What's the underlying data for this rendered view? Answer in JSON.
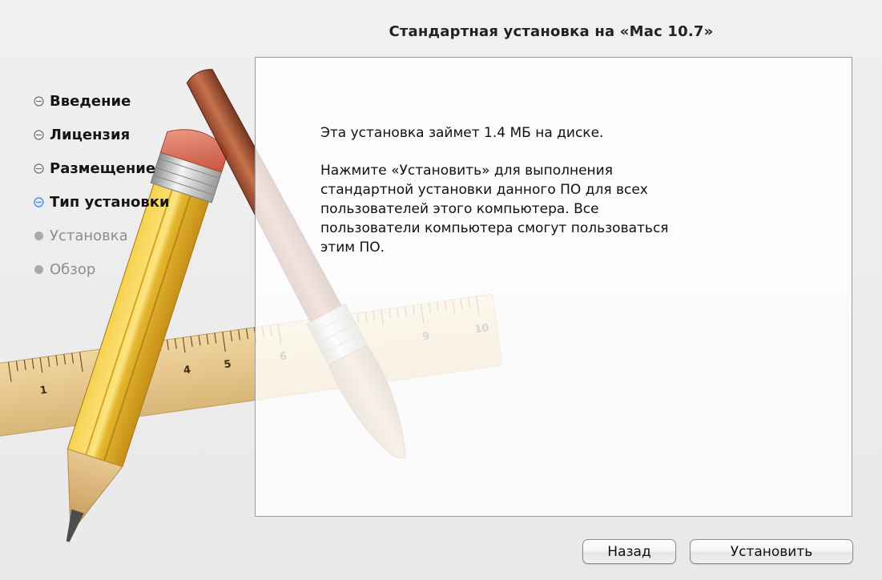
{
  "header": {
    "title": "Стандартная установка на «Mac 10.7»"
  },
  "steps": [
    {
      "label": "Введение",
      "state": "done"
    },
    {
      "label": "Лицензия",
      "state": "done"
    },
    {
      "label": "Размещение",
      "state": "done"
    },
    {
      "label": "Тип установки",
      "state": "current"
    },
    {
      "label": "Установка",
      "state": "pending"
    },
    {
      "label": "Обзор",
      "state": "pending"
    }
  ],
  "content": {
    "paragraph1": "Эта установка займет 1.4 МБ на диске.",
    "paragraph2": "Нажмите «Установить» для выполнения\nстандартной установки данного ПО для всех\nпользователей этого компьютера. Все\nпользователи компьютера смогут пользоваться\nэтим ПО."
  },
  "buttons": {
    "back": "Назад",
    "install": "Установить"
  },
  "colors": {
    "current_step": "#4f8fe0",
    "done_step": "#6e6e6e",
    "pending_step": "#a9a9a9"
  },
  "ruler_numbers": [
    "1",
    "4",
    "5",
    "6",
    "9",
    "10"
  ]
}
